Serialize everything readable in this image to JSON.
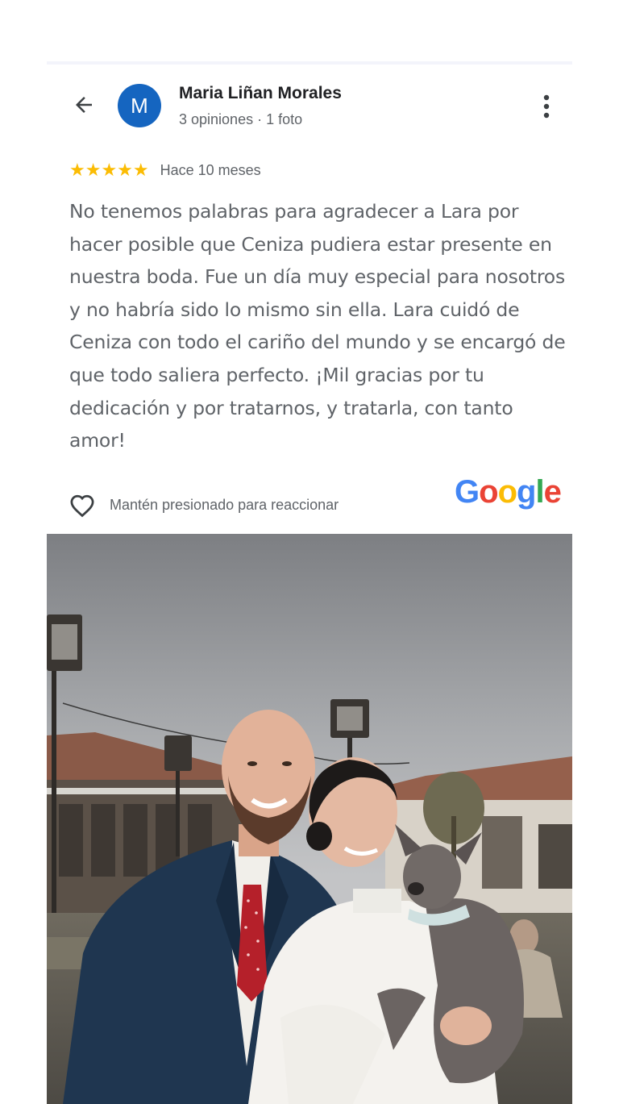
{
  "reviewer": {
    "name": "Maria Liñan Morales",
    "initial": "M",
    "meta": "3 opiniones · 1 foto",
    "avatar_color": "#1565c0"
  },
  "review": {
    "stars": 5,
    "star_glyphs": "★★★★★",
    "time": "Hace 10 meses",
    "text": "No tenemos palabras para agradecer a Lara por hacer posible que Ceniza pudiera estar presente en nuestra boda. Fue un día muy especial para nosotros y no habría sido lo mismo sin ella. Lara cuidó de Ceniza con todo el cariño del mundo y se encargó de que todo saliera perfecto. ¡Mil gracias por tu dedicación y por tratarnos, y tratarla, con tanto amor!"
  },
  "reaction": {
    "label": "Mantén presionado para reaccionar",
    "icon": "heart-outline-icon"
  },
  "brand": {
    "letters": [
      "G",
      "o",
      "o",
      "g",
      "l",
      "e"
    ],
    "colors": [
      "#4285F4",
      "#EA4335",
      "#FBBC05",
      "#4285F4",
      "#34A853",
      "#EA4335"
    ]
  },
  "icons": {
    "back": "arrow-back-icon",
    "more": "more-vert-icon",
    "star": "star-icon"
  },
  "colors": {
    "star": "#fbbc04",
    "text_secondary": "#5f6368",
    "text_primary": "#202124"
  }
}
